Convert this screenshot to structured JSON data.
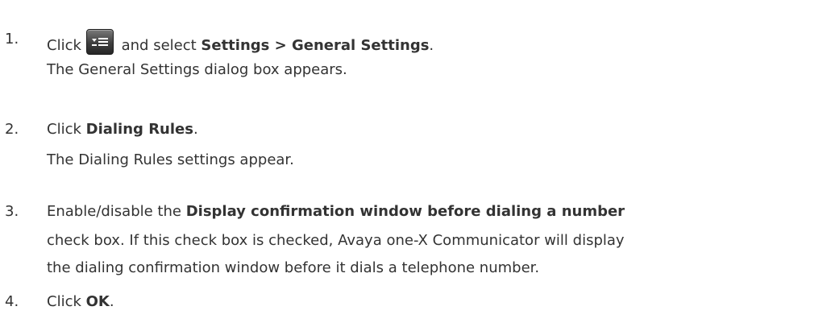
{
  "steps": [
    {
      "number": "1.",
      "line1": {
        "pre": "Click",
        "icon": "menu-list-icon",
        "mid": " and select ",
        "bold": "Settings > General Settings",
        "post": "."
      },
      "line2": "The General Settings dialog box appears."
    },
    {
      "number": "2.",
      "line1": {
        "pre": "Click ",
        "bold": "Dialing Rules",
        "post": "."
      },
      "line2": "The Dialing Rules settings appear."
    },
    {
      "number": "3.",
      "line1": {
        "pre": "Enable/disable the ",
        "bold": "Display confirmation window before dialing a number"
      },
      "line2": "check box. If this check box is checked, Avaya one-X Communicator will display",
      "line3": "the dialing confirmation window before it dials a telephone number."
    },
    {
      "number": "4.",
      "line1": {
        "pre": "Click ",
        "bold": "OK",
        "post": "."
      }
    }
  ]
}
